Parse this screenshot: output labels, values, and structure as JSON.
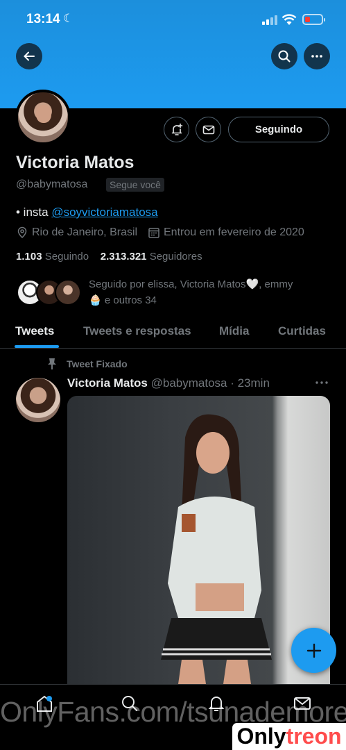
{
  "status_bar": {
    "time": "13:14"
  },
  "header": {
    "back_icon": "arrow-left-icon",
    "search_icon": "search-icon",
    "more_icon": "more-horizontal-icon"
  },
  "profile": {
    "name": "Victoria Matos",
    "handle": "@babymatosa",
    "follows_you": "Segue você",
    "follow_button": "Seguindo",
    "bio_prefix": "• insta ",
    "bio_link": "@soyvictoriamatosa",
    "location": "Rio de Janeiro, Brasil",
    "joined": "Entrou em fevereiro de 2020",
    "following_count": "1.103",
    "following_label": "Seguindo",
    "followers_count": "2.313.321",
    "followers_label": "Seguidores",
    "followed_by_line1": "Seguido por elissa, Victoria Matos🤍, emmy",
    "followed_by_line2": "🧁 e outros 34"
  },
  "tabs": [
    {
      "label": "Tweets",
      "active": true
    },
    {
      "label": "Tweets e respostas",
      "active": false
    },
    {
      "label": "Mídia",
      "active": false
    },
    {
      "label": "Curtidas",
      "active": false
    }
  ],
  "tweet": {
    "pinned_label": "Tweet Fixado",
    "author_name": "Victoria Matos",
    "author_handle": "@babymatosa",
    "time": " · 23min"
  },
  "fab": {
    "icon": "plus-icon"
  },
  "bottom_nav": [
    "home-icon",
    "search-icon",
    "notifications-icon",
    "messages-icon"
  ],
  "watermark": {
    "text": "OnlyFans.com/tsunademore",
    "logo_a": "Only",
    "logo_b": "treon"
  },
  "colors": {
    "accent": "#1d9bf0",
    "background": "#000000",
    "secondary_text": "#71767b"
  }
}
